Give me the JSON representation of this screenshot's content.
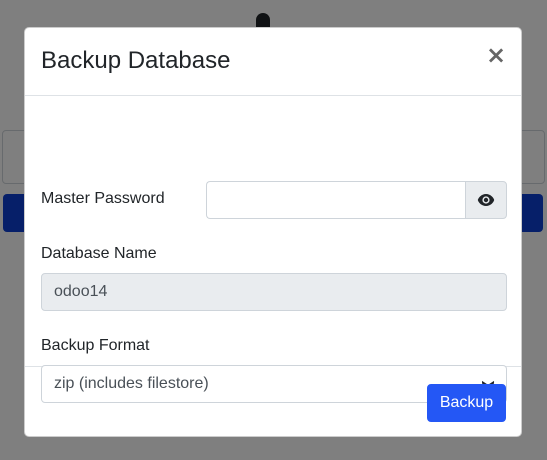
{
  "modal": {
    "title": "Backup Database",
    "close_label": "×",
    "master_password": {
      "label": "Master Password",
      "value": "",
      "toggle_icon": "eye-icon"
    },
    "database_name": {
      "label": "Database Name",
      "value": "odoo14"
    },
    "backup_format": {
      "label": "Backup Format",
      "selected": "zip (includes filestore)"
    },
    "submit_label": "Backup"
  },
  "colors": {
    "primary": "#2457f5",
    "overlay": "#808080",
    "readonly_bg": "#e9ecef"
  }
}
